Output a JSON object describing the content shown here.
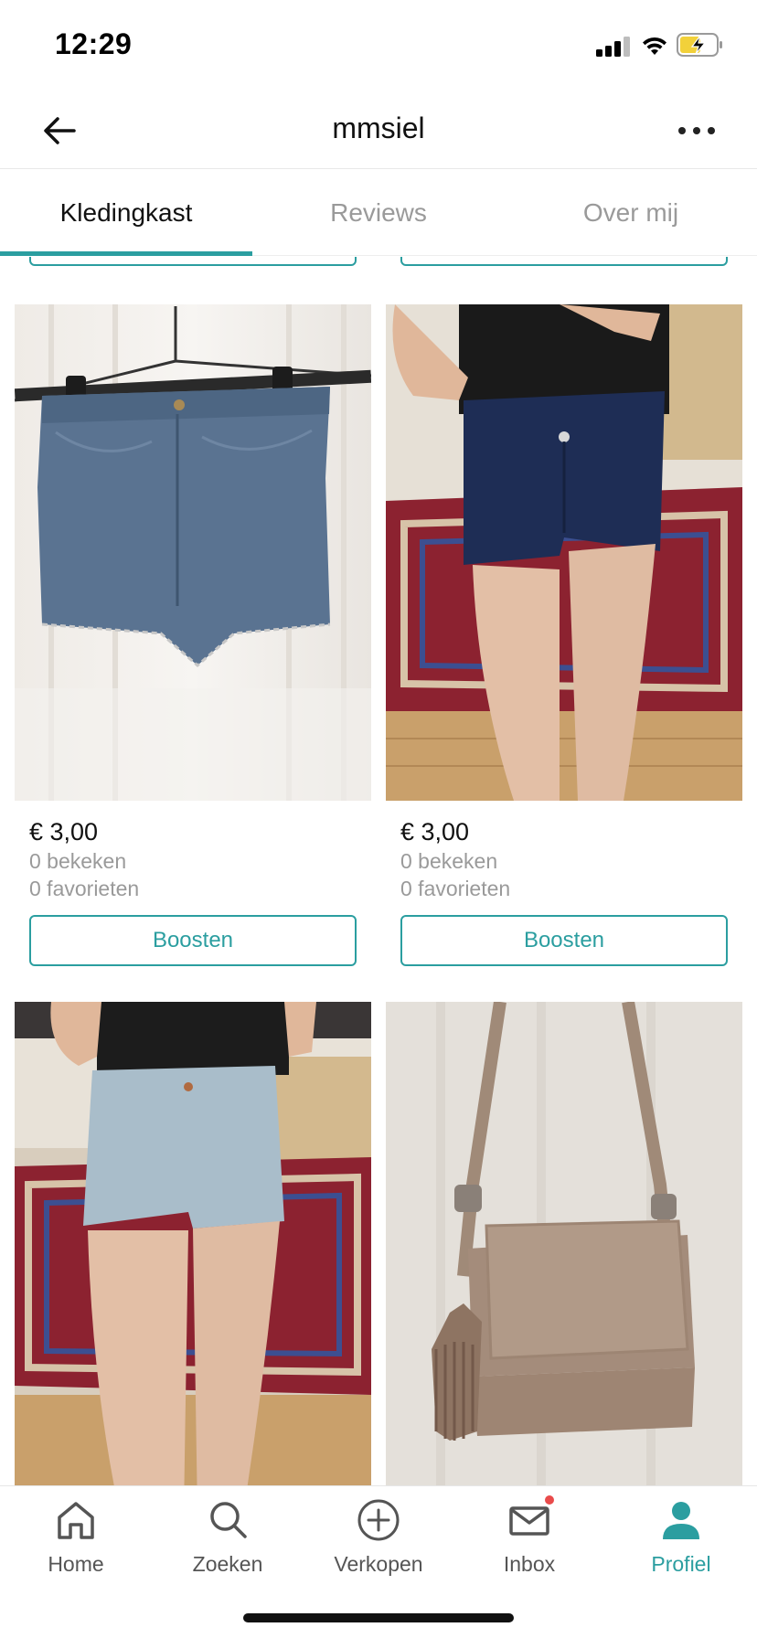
{
  "status_bar": {
    "time": "12:29"
  },
  "header": {
    "title": "mmsiel",
    "back_icon": "arrow-left-icon",
    "more_icon": "more-horizontal-icon"
  },
  "tabs": [
    {
      "label": "Kledingkast",
      "active": true
    },
    {
      "label": "Reviews",
      "active": false
    },
    {
      "label": "Over mij",
      "active": false
    }
  ],
  "items": [
    {
      "price": "€ 3,00",
      "views": "0 bekeken",
      "favorites": "0 favorieten",
      "button": "Boosten",
      "image": "denim-shorts-on-hanger"
    },
    {
      "price": "€ 3,00",
      "views": "0 bekeken",
      "favorites": "0 favorieten",
      "button": "Boosten",
      "image": "dark-denim-shorts-worn"
    },
    {
      "image": "light-denim-shorts-worn"
    },
    {
      "image": "suede-bag-with-fringe"
    }
  ],
  "bottom_nav": [
    {
      "label": "Home",
      "icon": "home-icon",
      "active": false
    },
    {
      "label": "Zoeken",
      "icon": "search-icon",
      "active": false
    },
    {
      "label": "Verkopen",
      "icon": "plus-circle-icon",
      "active": false
    },
    {
      "label": "Inbox",
      "icon": "mail-icon",
      "active": false,
      "badge": true
    },
    {
      "label": "Profiel",
      "icon": "profile-icon",
      "active": true
    }
  ],
  "colors": {
    "accent": "#2b9ea0",
    "badge": "#e94b4b",
    "muted": "#9a9a9a"
  }
}
